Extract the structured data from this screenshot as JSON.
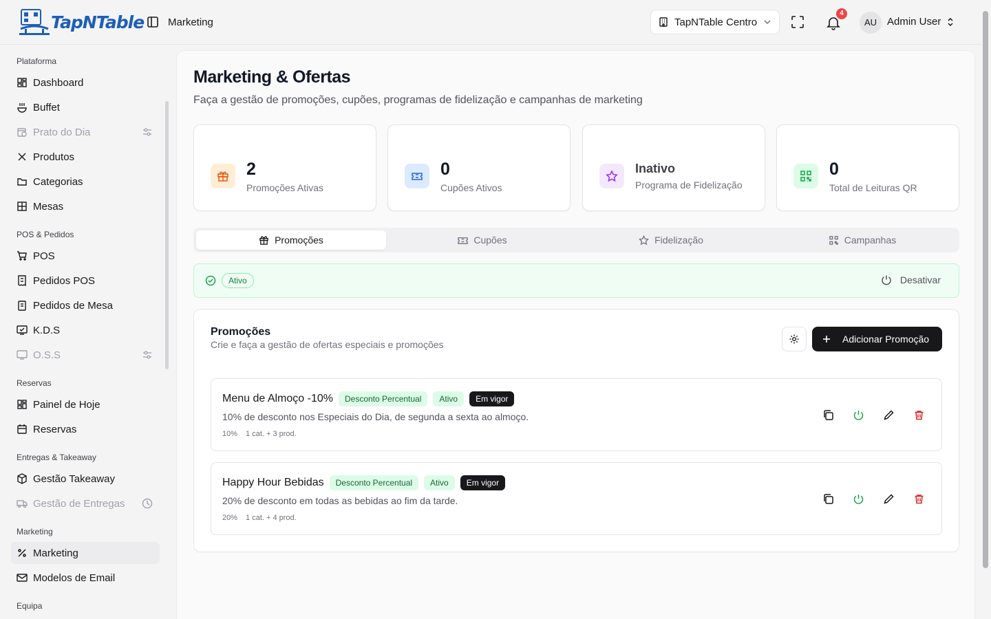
{
  "app": {
    "name": "TapNTable"
  },
  "header": {
    "breadcrumb": "Marketing",
    "store": "TapNTable Centro",
    "notifications_count": "4",
    "user_initials": "AU",
    "user_name": "Admin User"
  },
  "sidebar": {
    "groups": {
      "plataforma": "Plataforma",
      "pos": "POS & Pedidos",
      "reservas": "Reservas",
      "entregas": "Entregas & Takeaway",
      "marketing": "Marketing",
      "equipa": "Equipa"
    },
    "items": {
      "dashboard": "Dashboard",
      "buffet": "Buffet",
      "prato": "Prato do Dia",
      "produtos": "Produtos",
      "categorias": "Categorias",
      "mesas": "Mesas",
      "pos": "POS",
      "pedidos_pos": "Pedidos POS",
      "pedidos_mesa": "Pedidos de Mesa",
      "kds": "K.D.S",
      "oss": "O.S.S",
      "painel": "Painel de Hoje",
      "reservas": "Reservas",
      "takeaway": "Gestão Takeaway",
      "entregas": "Gestão de Entregas",
      "marketing": "Marketing",
      "email": "Modelos de Email"
    }
  },
  "page": {
    "title": "Marketing & Ofertas",
    "subtitle": "Faça a gestão de promoções, cupões, programas de fidelização e campanhas de marketing"
  },
  "stats": [
    {
      "value": "2",
      "label": "Promoções Ativas",
      "icon": "gift-icon",
      "color": "#ea580c"
    },
    {
      "value": "0",
      "label": "Cupões Ativos",
      "icon": "ticket-icon",
      "color": "#2563eb"
    },
    {
      "value": "Inativo",
      "label": "Programa de Fidelização",
      "icon": "star-icon",
      "color": "#9333ea"
    },
    {
      "value": "0",
      "label": "Total de Leituras QR",
      "icon": "qr-icon",
      "color": "#16a34a"
    }
  ],
  "tabs": {
    "promocoes": "Promoções",
    "cupoes": "Cupões",
    "fidelizacao": "Fidelização",
    "campanhas": "Campanhas"
  },
  "status": {
    "badge": "Ativo",
    "action": "Desativar"
  },
  "promotions": {
    "title": "Promoções",
    "subtitle": "Crie e faça a gestão de ofertas especiais e promoções",
    "add_label": "Adicionar Promoção",
    "items": [
      {
        "name": "Menu de Almoço -10%",
        "type": "Desconto Percentual",
        "status": "Ativo",
        "validity": "Em vigor",
        "description": "10% de desconto nos Especiais do Dia, de segunda a sexta ao almoço.",
        "discount": "10%",
        "scope": "1 cat. + 3 prod."
      },
      {
        "name": "Happy Hour Bebidas",
        "type": "Desconto Percentual",
        "status": "Ativo",
        "validity": "Em vigor",
        "description": "20% de desconto em todas as bebidas ao fim da tarde.",
        "discount": "20%",
        "scope": "1 cat. + 4 prod."
      }
    ]
  }
}
